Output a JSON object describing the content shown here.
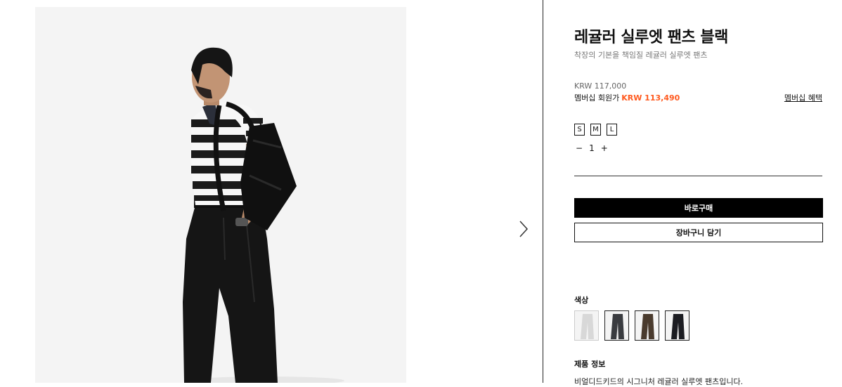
{
  "product": {
    "title": "레귤러 실루엣 팬츠 블랙",
    "subtitle": "착장의 기본을 책임질 레귤러 실루엣 팬츠",
    "price_original": "KRW 117,000",
    "member_label": "멤버십 회원가",
    "member_price": "KRW 113,490",
    "member_benefit_link": "멤버십 혜택",
    "member_price_color": "#ff5a1f"
  },
  "sizes": [
    "S",
    "M",
    "L"
  ],
  "quantity": {
    "minus": "−",
    "value": "1",
    "plus": "+"
  },
  "actions": {
    "buy_now": "바로구매",
    "add_to_cart": "장바구니 담기"
  },
  "color": {
    "label": "색상",
    "swatches": [
      {
        "name": "light-gray",
        "color": "#d8d8d8"
      },
      {
        "name": "charcoal",
        "color": "#3a3c40"
      },
      {
        "name": "brown",
        "color": "#4a3b2e"
      },
      {
        "name": "black",
        "color": "#1c1d22"
      }
    ]
  },
  "details": {
    "label": "제품 정보",
    "text": "비얼디드키드의 시그니처 레귤러 실루엣 팬츠입니다."
  },
  "gallery": {
    "next_icon": "chevron-right-icon"
  }
}
